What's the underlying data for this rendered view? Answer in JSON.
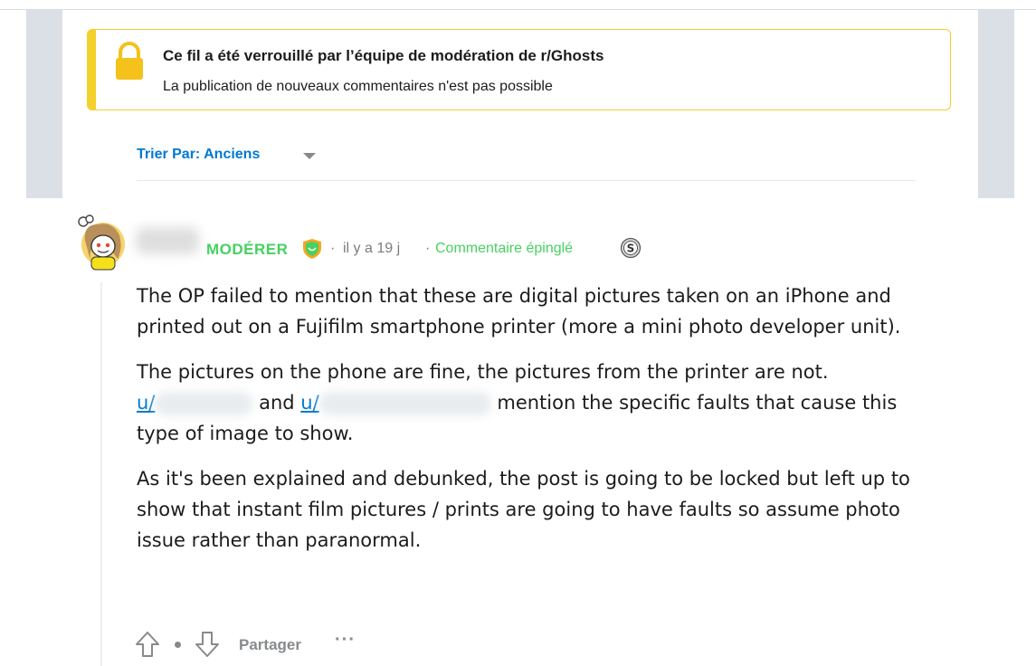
{
  "lock_banner": {
    "title": "Ce fil a été verrouillé par l’équipe de modération de r/Ghosts",
    "subtitle": "La publication de nouveaux commentaires n'est pas possible",
    "icon": "lock-icon",
    "accent_color": "#f4d02b"
  },
  "sort": {
    "label": "Trier Par: Anciens",
    "icon": "chevron-down-icon"
  },
  "comment": {
    "moderator_label": "MODÉRER",
    "separator": "·",
    "time": "il y a 19 j",
    "pinned_label": "Commentaire épinglé",
    "paragraphs": [
      "The OP failed to mention that these are digital pictures taken on an iPhone and printed out on a Fujifilm smartphone printer (more a mini photo developer unit).",
      "The pictures on the phone are fine, the pictures from the printer are not.",
      "As it's been explained and debunked, the post is going to be locked but left up to show that instant film pictures / prints are going to have faults so assume photo issue rather than paranormal."
    ],
    "mention_prefix_1": "u/",
    "mention_and": "and",
    "mention_prefix_2": "u/",
    "mention_tail": "mention the specific faults that cause this type of image to show.",
    "moderator_color": "#46d160"
  },
  "actions": {
    "share_label": "Partager",
    "more_label": "···"
  },
  "colors": {
    "link": "#0079d3",
    "muted": "#878a8c"
  }
}
